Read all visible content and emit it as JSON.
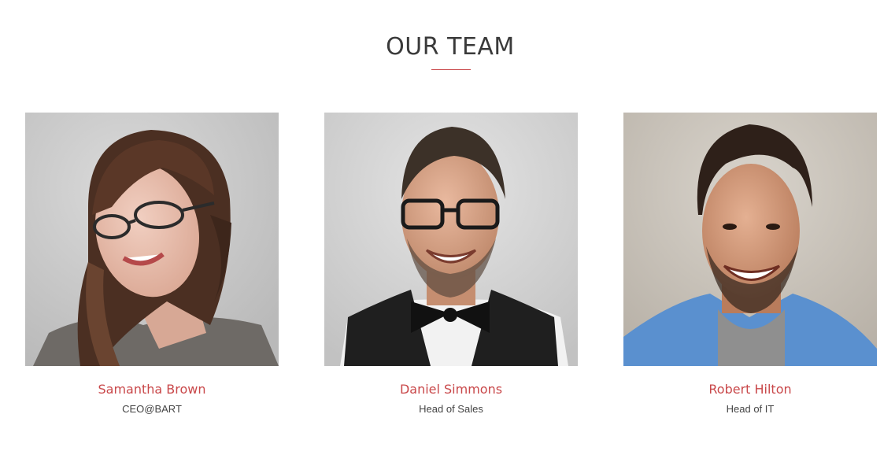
{
  "section": {
    "title": "OUR TEAM",
    "accent_color": "#c9484a"
  },
  "members": [
    {
      "name": "Samantha Brown",
      "role": "CEO@BART",
      "photo": "woman-with-glasses-portrait"
    },
    {
      "name": "Daniel Simmons",
      "role": "Head of Sales",
      "photo": "man-with-bowtie-portrait"
    },
    {
      "name": "Robert Hilton",
      "role": "Head of IT",
      "photo": "man-in-denim-shirt-portrait"
    }
  ]
}
